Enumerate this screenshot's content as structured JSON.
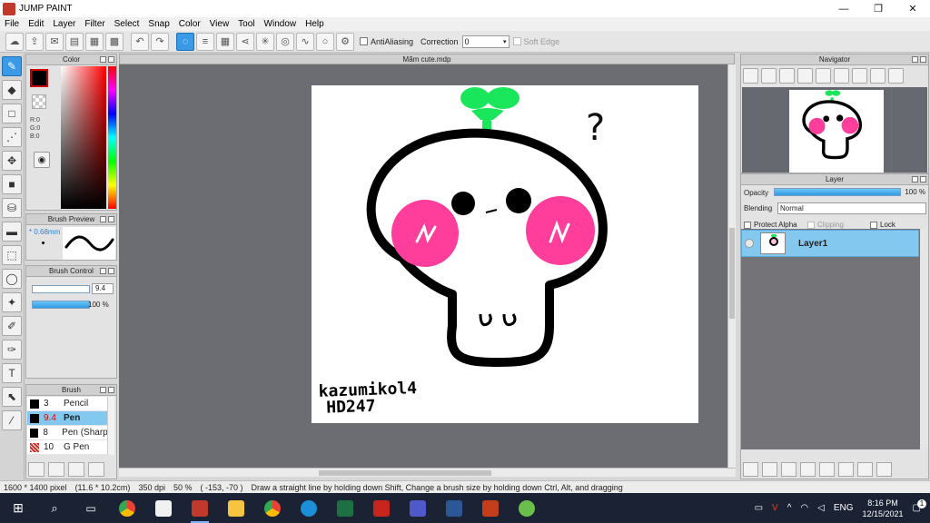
{
  "window": {
    "title": "JUMP PAINT",
    "minimize": "—",
    "maximize": "❐",
    "close": "✕"
  },
  "menu": [
    "File",
    "Edit",
    "Layer",
    "Filter",
    "Select",
    "Snap",
    "Color",
    "View",
    "Tool",
    "Window",
    "Help"
  ],
  "toolbar": {
    "anti_aliasing_label": "AntiAliasing",
    "correction_label": "Correction",
    "correction_value": "0",
    "soft_edge_label": "Soft Edge"
  },
  "panels": {
    "color": {
      "title": "Color",
      "r": "R:0",
      "g": "G:0",
      "b": "B:0"
    },
    "brush_preview": {
      "title": "Brush Preview",
      "size": "* 0.68mm"
    },
    "brush_control": {
      "title": "Brush Control",
      "size_value": "9.4",
      "opacity_value": "100 %",
      "size_fraction": 0.55,
      "opacity_fraction": 1.0
    },
    "brush": {
      "title": "Brush",
      "items": [
        {
          "size": "3",
          "name": "Pencil",
          "swatch": "#000000"
        },
        {
          "size": "9.4",
          "name": "Pen",
          "swatch": "#000000"
        },
        {
          "size": "8",
          "name": "Pen (Sharp)",
          "swatch": "#000000"
        },
        {
          "size": "10",
          "name": "G Pen",
          "swatch": "#d0302a"
        }
      ],
      "selected_index": 1
    },
    "navigator": {
      "title": "Navigator"
    },
    "layer": {
      "title": "Layer",
      "opacity_label": "Opacity",
      "opacity_value": "100 %",
      "blending_label": "Blending",
      "blending_value": "Normal",
      "protect_alpha_label": "Protect Alpha",
      "clipping_label": "Clipping",
      "lock_label": "Lock",
      "layers": [
        {
          "name": "Layer1"
        }
      ]
    }
  },
  "document": {
    "tab_title": "Mãm cute.mdp",
    "signature_line1": "kazumikol4",
    "signature_line2": "HD247",
    "question_mark": "?"
  },
  "status": {
    "pixels": "1600 * 1400 pixel",
    "size_cm": "(11.6 * 10.2cm)",
    "dpi": "350 dpi",
    "zoom": "50 %",
    "coords": "( -153, -70 )",
    "hint": "Draw a straight line by holding down Shift, Change a brush size by holding down Ctrl, Alt, and dragging"
  },
  "taskbar": {
    "lang": "ENG",
    "time": "8:16 PM",
    "date": "12/15/2021",
    "notification_count": "1"
  },
  "colors": {
    "accent": "#3a9ae8",
    "selection": "#82c8ef",
    "canvas_bg": "#6b6d73",
    "sprout": "#19e65a",
    "blush": "#ff3d9a",
    "taskbar": "#1a2233"
  }
}
